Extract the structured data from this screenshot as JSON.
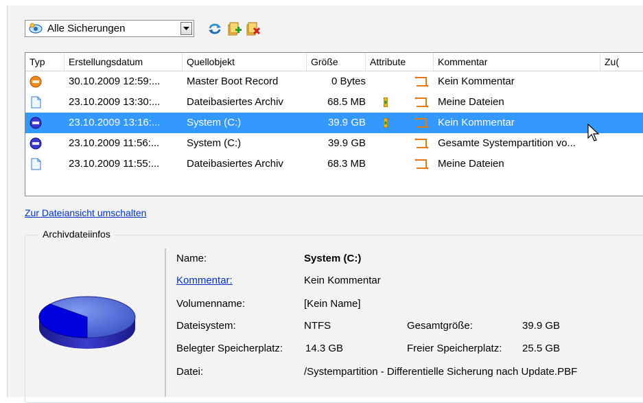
{
  "toolbar": {
    "combo_value": "Alle Sicherungen",
    "combo_icon": "backup-eye-icon",
    "buttons": [
      "refresh-icon",
      "add-backup-icon",
      "delete-backup-icon"
    ]
  },
  "table": {
    "columns": [
      "Typ",
      "Erstellungsdatum",
      "Quellobjekt",
      "Größe",
      "Attribute",
      "Kommentar",
      "Zu("
    ],
    "rows": [
      {
        "type_icon": "mbr-disk-icon",
        "date": "30.10.2009 12:59:...",
        "source": "Master Boot Record",
        "size": "0 Bytes",
        "has_attr": false,
        "comment": "Kein Kommentar",
        "selected": false
      },
      {
        "type_icon": "file-archive-icon",
        "date": "23.10.2009 13:30:...",
        "source": "Dateibasiertes Archiv",
        "size": "68.5 MB",
        "has_attr": true,
        "comment": "Meine Dateien",
        "selected": false
      },
      {
        "type_icon": "partition-disk-icon",
        "date": "23.10.2009 13:16:...",
        "source": "System (C:)",
        "size": "39.9 GB",
        "has_attr": true,
        "comment": "Kein Kommentar",
        "selected": true
      },
      {
        "type_icon": "partition-disk-icon",
        "date": "23.10.2009 11:56:...",
        "source": "System (C:)",
        "size": "39.9 GB",
        "has_attr": false,
        "comment": "Gesamte Systempartition vo...",
        "selected": false
      },
      {
        "type_icon": "file-archive-icon",
        "date": "23.10.2009 11:55:...",
        "source": "Dateibasiertes Archiv",
        "size": "68.3 MB",
        "has_attr": false,
        "comment": "Meine Dateien",
        "selected": false
      }
    ]
  },
  "switch_link": "Zur Dateiansicht umschalten",
  "archive_info": {
    "group_title": "Archivdateiinfos",
    "name_label": "Name:",
    "name_value": "System (C:)",
    "comment_label": "Kommentar:",
    "comment_value": "Kein Kommentar",
    "volume_label": "Volumenname:",
    "volume_value": "[Kein Name]",
    "fs_label": "Dateisystem:",
    "fs_value": "NTFS",
    "total_label": "Gesamtgröße:",
    "total_value": "39.9 GB",
    "used_label": "Belegter Speicherplatz:",
    "used_value": "14.3 GB",
    "free_label": "Freier Speicherplatz:",
    "free_value": "25.5 GB",
    "file_label": "Datei:",
    "file_value": "/Systempartition - Differentielle Sicherung nach Update.PBF",
    "used_fraction": 0.36
  }
}
